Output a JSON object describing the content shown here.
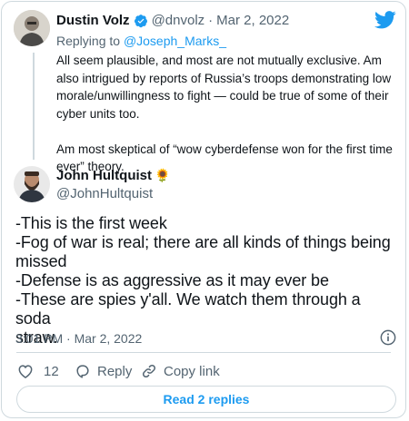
{
  "parent": {
    "author_name": "Dustin Volz",
    "handle": "@dnvolz",
    "separator": "·",
    "date": "Mar 2, 2022",
    "replying_prefix": "Replying to ",
    "replying_to": "@Joseph_Marks_",
    "paragraph1_line1": "All seem plausible, and most are not mutually exclusive. Am",
    "paragraph1_line2": "also intrigued by reports of Russia’s troops demonstrating low",
    "paragraph1_line3": "morale/unwillingness to fight — could be true of some of their",
    "paragraph1_line4": "cyber units too.",
    "paragraph2_line1": "Am most skeptical of “wow cyberdefense won for the first time",
    "paragraph2_line2": "ever” theory."
  },
  "main": {
    "author_name": "John Hultquist",
    "author_emoji": "🌻",
    "handle": "@JohnHultquist",
    "lines": [
      "-This is the first week",
      "-Fog of war is real; there are all kinds of things being",
      "missed",
      "-Defense is as aggressive as it may ever be",
      "-These are spies y'all. We watch them through a soda",
      "straw."
    ],
    "timestamp": "3:01 PM · Mar 2, 2022"
  },
  "actions": {
    "like_count": "12",
    "reply_label": "Reply",
    "copy_label": "Copy link"
  },
  "read_replies_label": "Read 2 replies",
  "icons": {
    "twitter": "twitter-bird-icon",
    "verified": "verified-badge-icon",
    "info": "info-icon",
    "heart": "heart-icon",
    "reply": "reply-bubble-icon",
    "link": "link-icon"
  },
  "colors": {
    "brand_blue": "#1d9bf0",
    "like_red": "#f91880",
    "text": "#0f1419",
    "muted": "#536471",
    "border": "#cfd9de"
  }
}
